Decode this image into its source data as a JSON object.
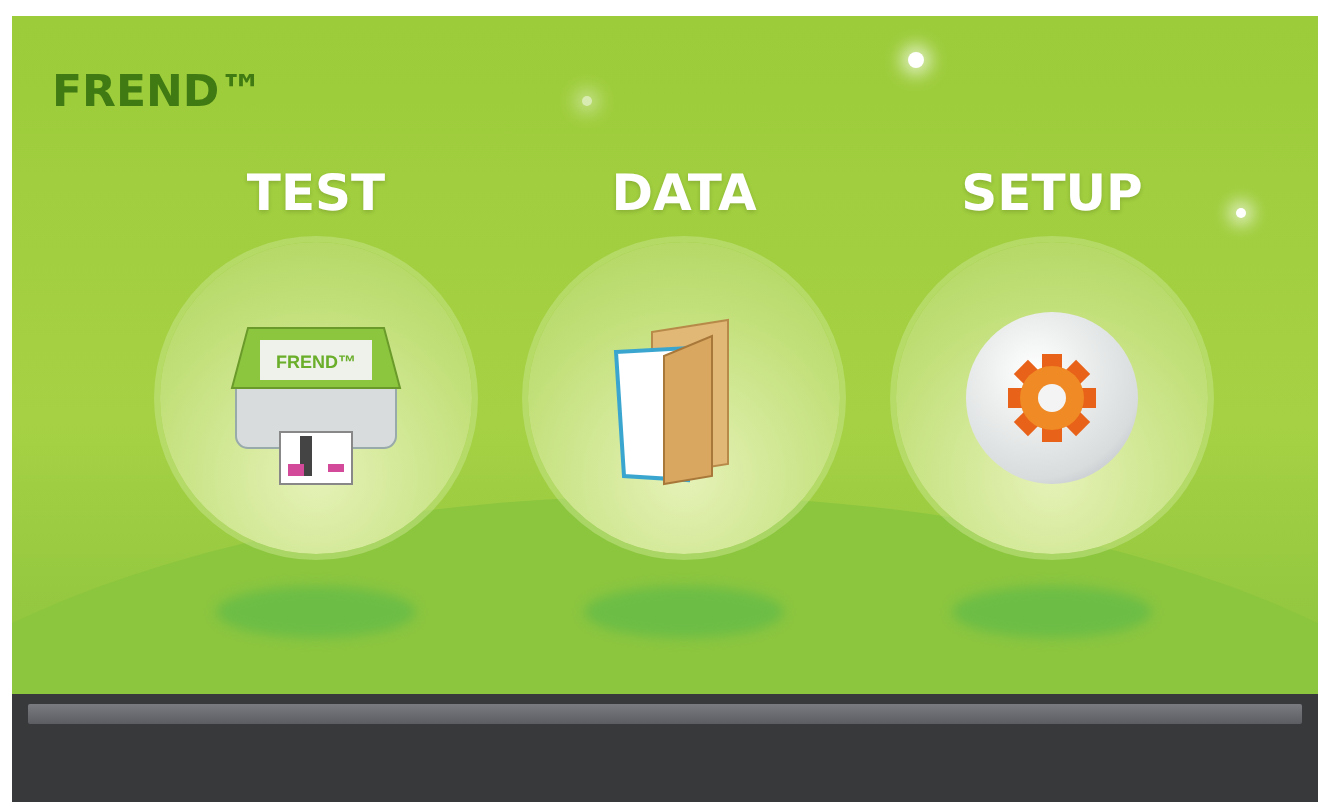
{
  "logo": {
    "text": "FREND™"
  },
  "menu": [
    {
      "label": "TEST",
      "kind": "test",
      "icon_text": "FREND™"
    },
    {
      "label": "DATA",
      "kind": "data"
    },
    {
      "label": "SETUP",
      "kind": "setup"
    }
  ]
}
